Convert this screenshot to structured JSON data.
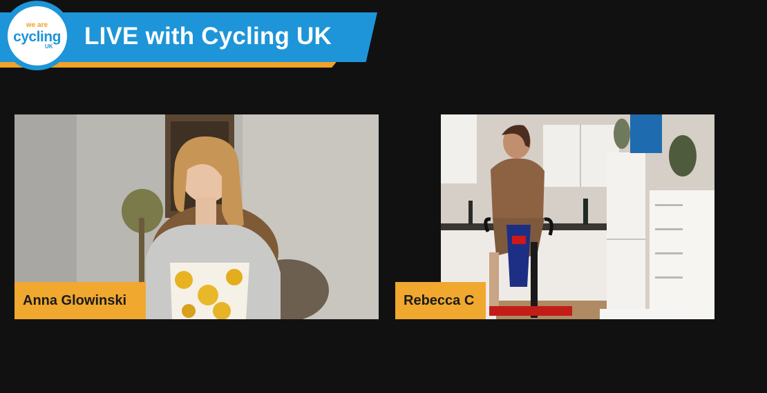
{
  "header": {
    "title": "LIVE with Cycling UK",
    "logo": {
      "line1": "we are",
      "line2": "cycling",
      "line3": "UK"
    }
  },
  "colors": {
    "background": "#121112",
    "brand_blue": "#1e95d8",
    "brand_orange": "#f0a324",
    "name_tag": "#f0a82f"
  },
  "participants": [
    {
      "name": "Anna Glowinski"
    },
    {
      "name": "Rebecca C"
    }
  ]
}
